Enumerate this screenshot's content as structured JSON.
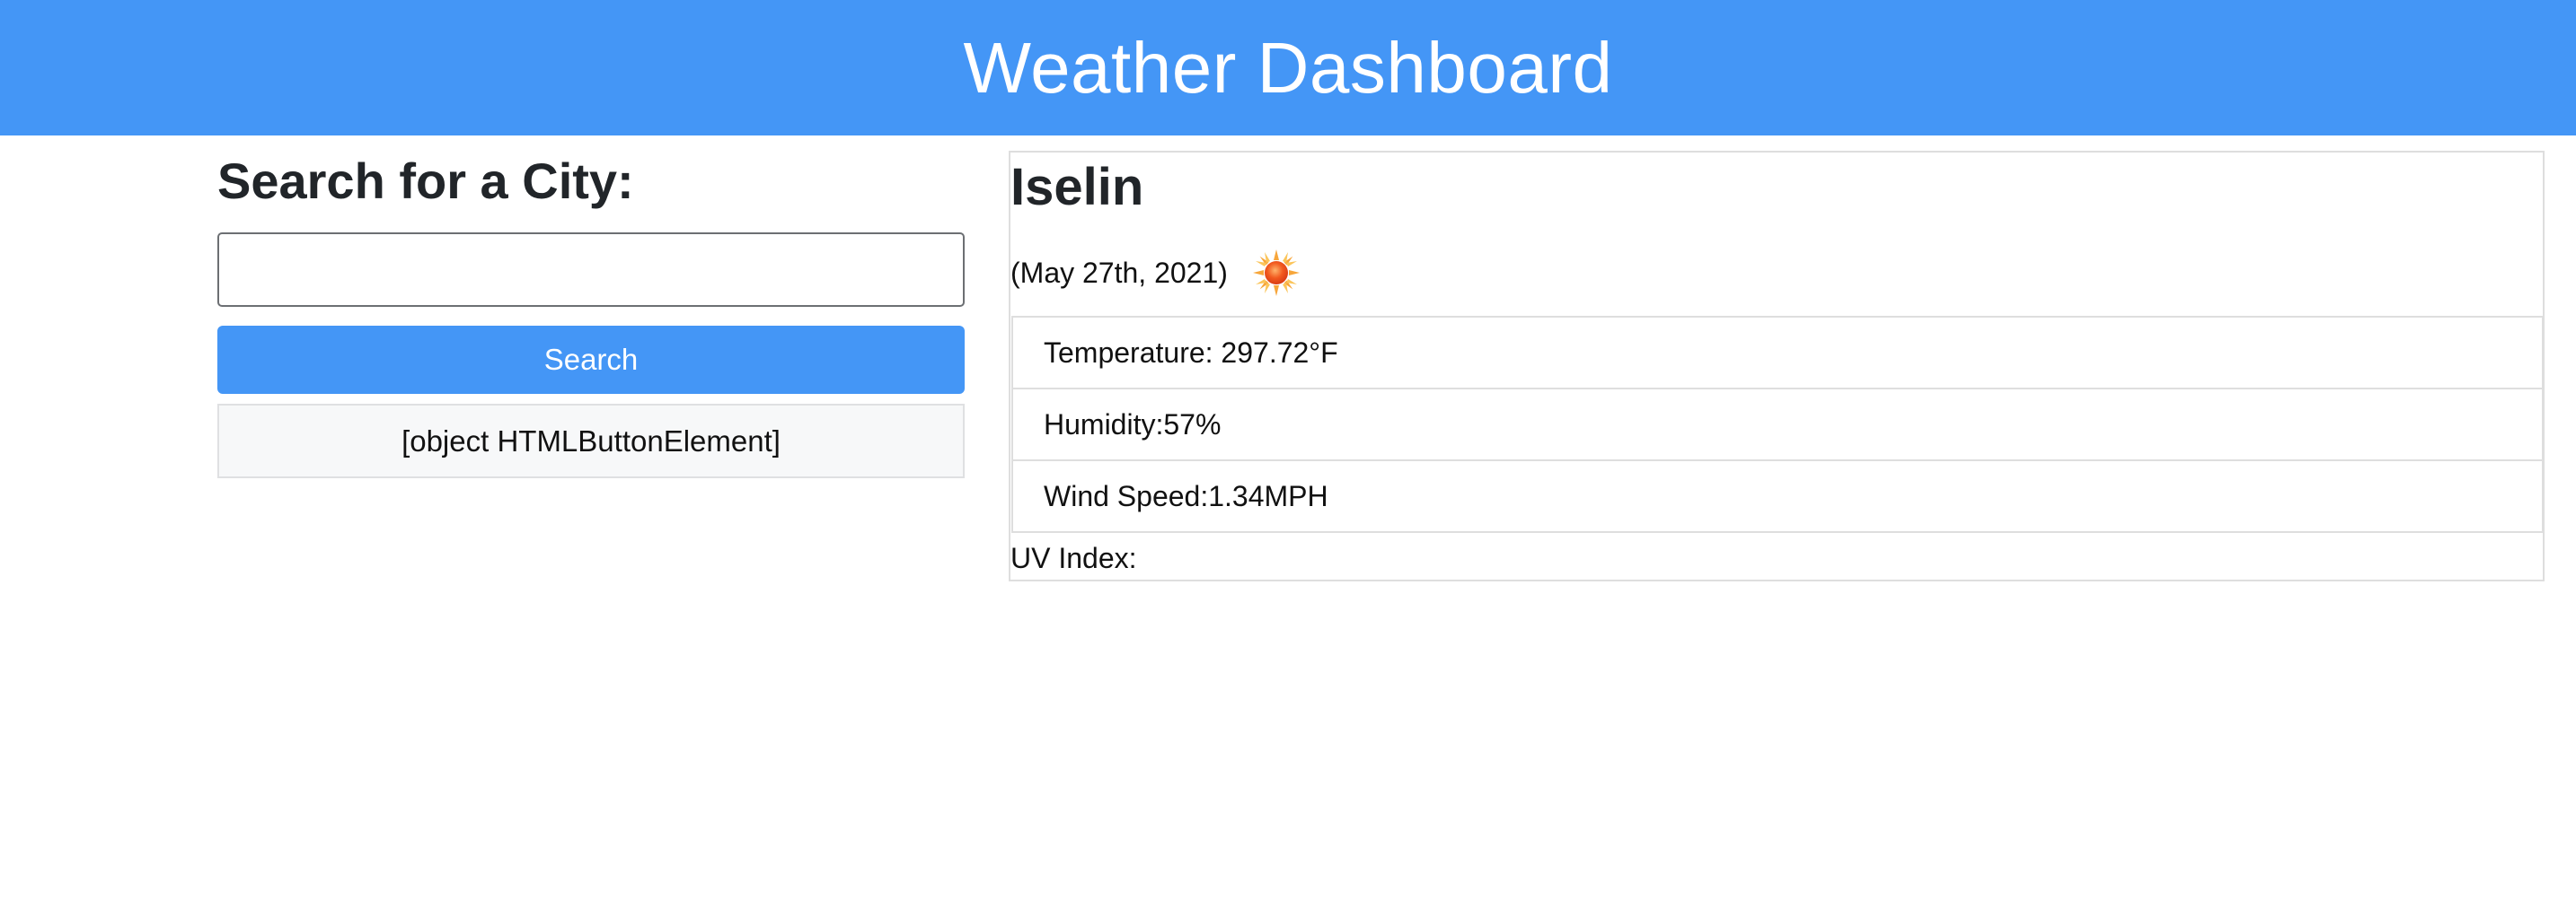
{
  "header": {
    "title": "Weather Dashboard"
  },
  "search": {
    "heading": "Search for a City:",
    "input_value": "",
    "button_label": "Search",
    "history": [
      "[object HTMLButtonElement]"
    ]
  },
  "current": {
    "city": "Iselin",
    "date": "(May 27th, 2021)",
    "icon": "sun-icon",
    "temperature": "Temperature: 297.72°F",
    "humidity": "Humidity:57%",
    "wind_speed": "Wind Speed:1.34MPH",
    "uv_index": "UV Index:"
  },
  "colors": {
    "header_bg": "#4496f6",
    "button_bg": "#4496f6",
    "history_bg": "#f7f8f9"
  }
}
